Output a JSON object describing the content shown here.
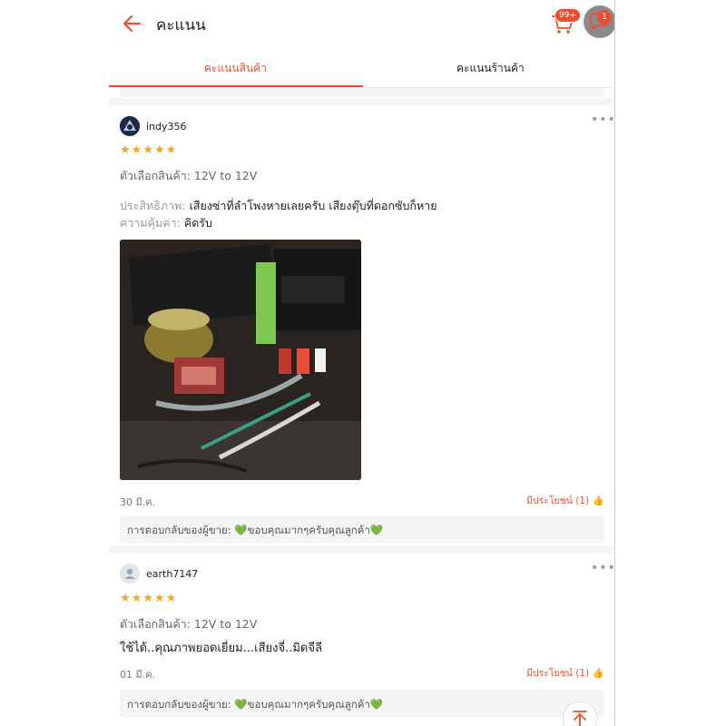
{
  "header": {
    "title": "คะแนน",
    "cart_badge": "99+",
    "chat_badge": "1",
    "icons": [
      "back-arrow-icon",
      "cart-icon",
      "chat-icon"
    ]
  },
  "tabs": [
    {
      "label": "คะแนนสินค้า",
      "active": true
    },
    {
      "label": "คะแนนร้านค้า",
      "active": false
    }
  ],
  "reviews": [
    {
      "username": "indy356",
      "stars": "★★★★★",
      "variation": "ตัวเลือกสินค้า: 12V to 12V",
      "attrs": [
        {
          "label": "ประสิทธิภาพ:",
          "value": "เสียงซ่าที่ลำโพงหายเลยครับ  เสียงตุ๊บที่ดอกซับก็หาย"
        },
        {
          "label": "ความคุ้มค่า:",
          "value": "คิดรับ"
        }
      ],
      "date": "30 มี.ค.",
      "helpful": "มีประโยชน์ (1)",
      "seller_reply": "การตอบกลับของผู้ขาย: 💚ขอบคุณมากๆครับคุณลูกค้า💚"
    },
    {
      "username": "earth7147",
      "stars": "★★★★★",
      "variation": "ตัวเลือกสินค้า: 12V to 12V",
      "comment": "ใช้ได้..คุณภาพยอดเยี่ยม...เสียงจี่..มิดจีลี",
      "date": "01 มี.ค.",
      "helpful": "มีประโยชน์ (1)",
      "seller_reply": "การตอบกลับของผู้ขาย: 💚ขอบคุณมากๆครับคุณลูกค้า💚"
    }
  ],
  "colors": {
    "accent": "#ee4d2d",
    "star": "#f5a623"
  }
}
